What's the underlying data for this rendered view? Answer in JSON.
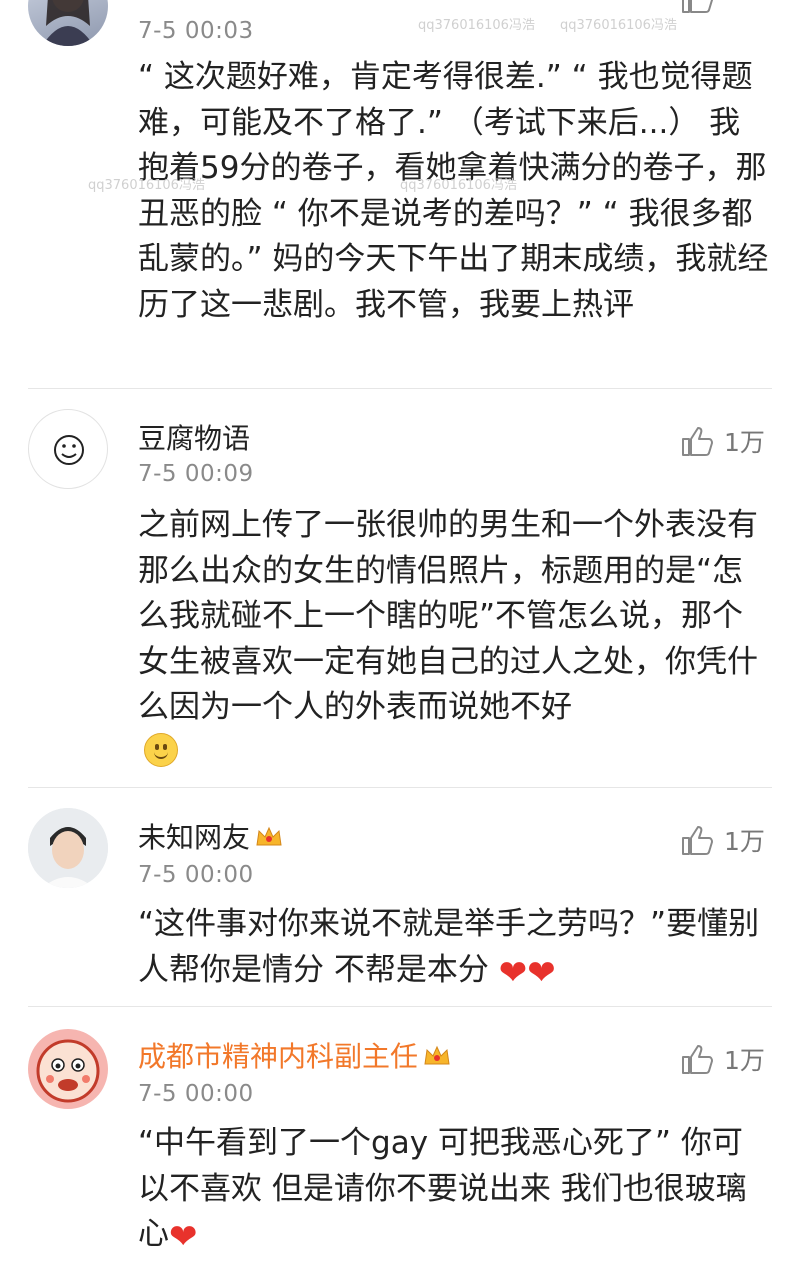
{
  "watermark": "qq376016106冯浩",
  "comments": [
    {
      "username": "",
      "timestamp": "7-5 00:03",
      "text": "“ 这次题好难，肯定考得很差.” “ 我也觉得题难，可能及不了格了.” （考试下来后...） 我抱着59分的卷子，看她拿着快满分的卷子，那丑恶的脸 “ 你不是说考的差吗？” “ 我很多都乱蒙的。” 妈的今天下午出了期末成绩，我就经历了这一悲剧。我不管，我要上热评",
      "like_count": ""
    },
    {
      "username": "豆腐物语",
      "timestamp": "7-5 00:09",
      "text": "之前网上传了一张很帅的男生和一个外表没有那么出众的女生的情侣照片，标题用的是“怎么我就碰不上一个瞎的呢”不管怎么说，那个女生被喜欢一定有她自己的过人之处，你凭什么因为一个人的外表而说她不好",
      "like_count": "1万"
    },
    {
      "username": "未知网友",
      "timestamp": "7-5 00:00",
      "text": "“这件事对你来说不就是举手之劳吗？”要懂别人帮你是情分 不帮是本分 ❤❤",
      "like_count": "1万"
    },
    {
      "username": "成都市精神内科副主任",
      "timestamp": "7-5 00:00",
      "text": "“中午看到了一个gay 可把我恶心死了” 你可以不喜欢 但是请你不要说出来 我们也很玻璃心❤",
      "like_count": "1万"
    }
  ],
  "colors": {
    "vip_name": "#f2782a",
    "heart": "#e8322c",
    "muted": "#8a8a8a"
  },
  "icons": {
    "like": "thumbs-up-icon",
    "vip": "crown-icon",
    "default_avatar": "smiley-icon"
  }
}
